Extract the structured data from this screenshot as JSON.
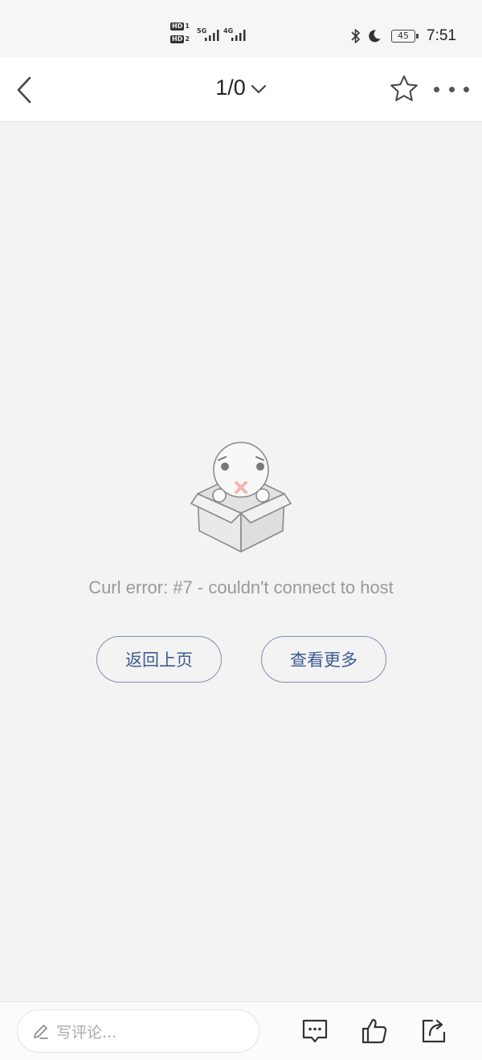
{
  "status_bar": {
    "hd1_label": "HD",
    "hd1_slot": "1",
    "hd2_label": "HD",
    "hd2_slot": "2",
    "signal1_gen": "5G",
    "signal2_gen": "4G",
    "battery_level": "45",
    "time": "7:51",
    "icons": [
      "bluetooth-icon",
      "moon-icon",
      "battery-icon"
    ]
  },
  "nav": {
    "title": "1/0",
    "icons": [
      "back-arrow-icon",
      "chevron-down-icon",
      "star-icon",
      "more-dots-icon"
    ]
  },
  "content": {
    "error_message": "Curl error: #7 - couldn't connect to host",
    "back_button_label": "返回上页",
    "more_button_label": "查看更多"
  },
  "bottom_bar": {
    "comment_placeholder": "写评论...",
    "icons": [
      "pencil-icon",
      "comment-icon",
      "thumbs-up-icon",
      "share-icon"
    ]
  },
  "colors": {
    "accent": "#3c5b94",
    "button_border": "#7e8fae",
    "background": "#f3f3f3",
    "error_text": "#9a9a9a"
  }
}
